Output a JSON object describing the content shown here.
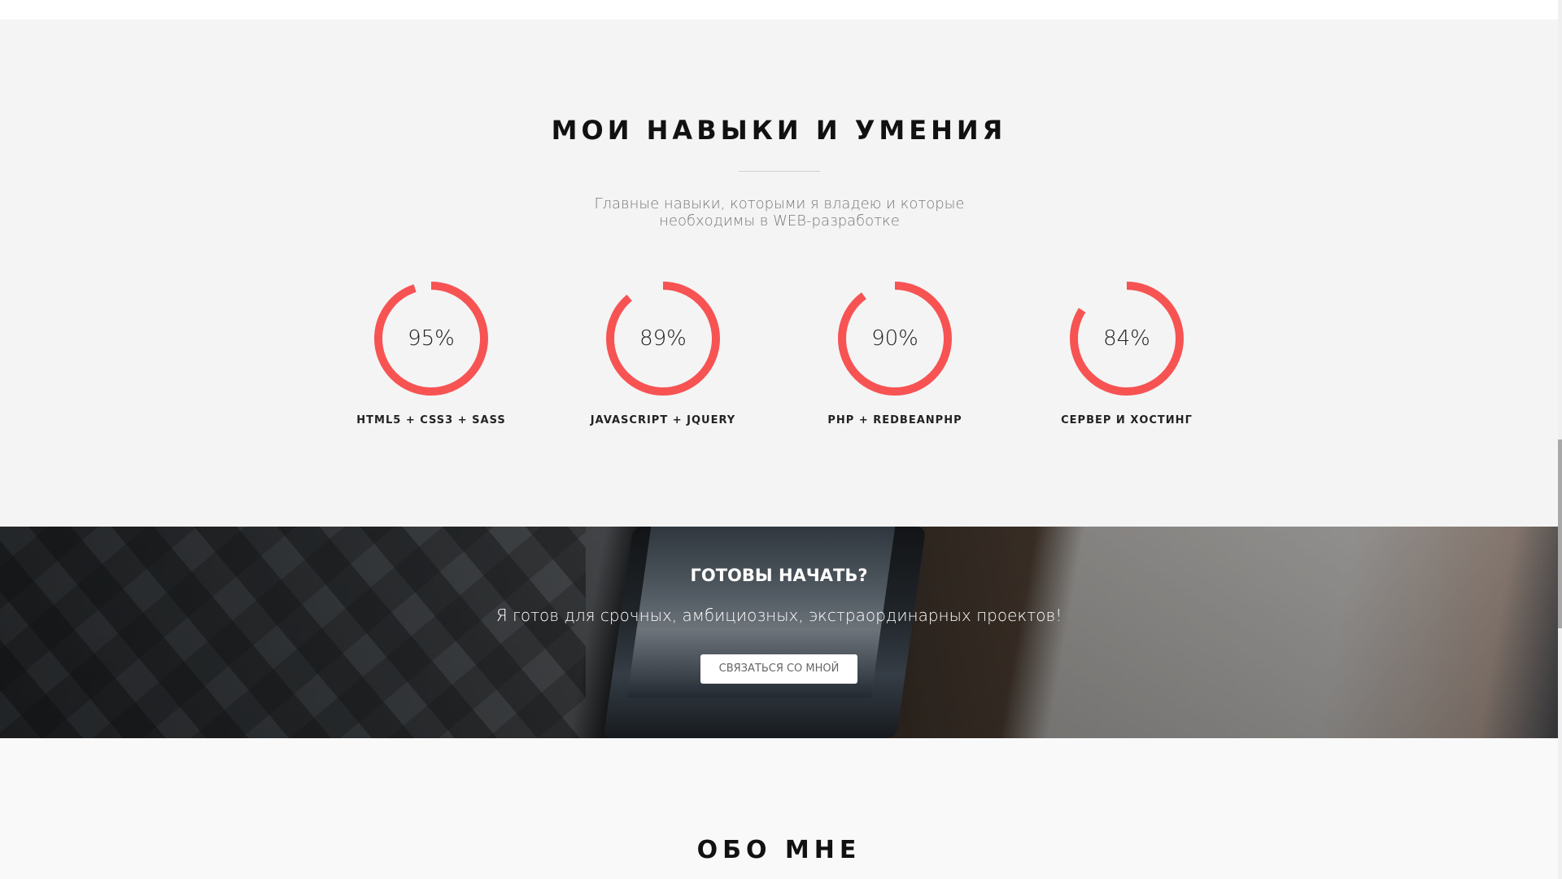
{
  "skills": {
    "title": "МОИ НАВЫКИ И УМЕНИЯ",
    "subtitle": "Главные навыки, которыми я владею и которые необходимы в WEB-разработке",
    "ring_color": "#f75353",
    "items": [
      {
        "percent_label": "95%",
        "value": 95,
        "label": "HTML5 + CSS3 + SASS"
      },
      {
        "percent_label": "89%",
        "value": 89,
        "label": "JAVASCRIPT + JQUERY"
      },
      {
        "percent_label": "90%",
        "value": 90,
        "label": "PHP + REDBEANPHP"
      },
      {
        "percent_label": "84%",
        "value": 84,
        "label": "СЕРВЕР И ХОСТИНГ"
      }
    ]
  },
  "cta": {
    "title": "ГОТОВЫ НАЧАТЬ?",
    "text": "Я готов для срочных, амбициозных, экстраординарных проектов!",
    "button_label": "СВЯЗАТЬСЯ СО МНОЙ"
  },
  "about": {
    "title": "ОБО МНЕ"
  }
}
